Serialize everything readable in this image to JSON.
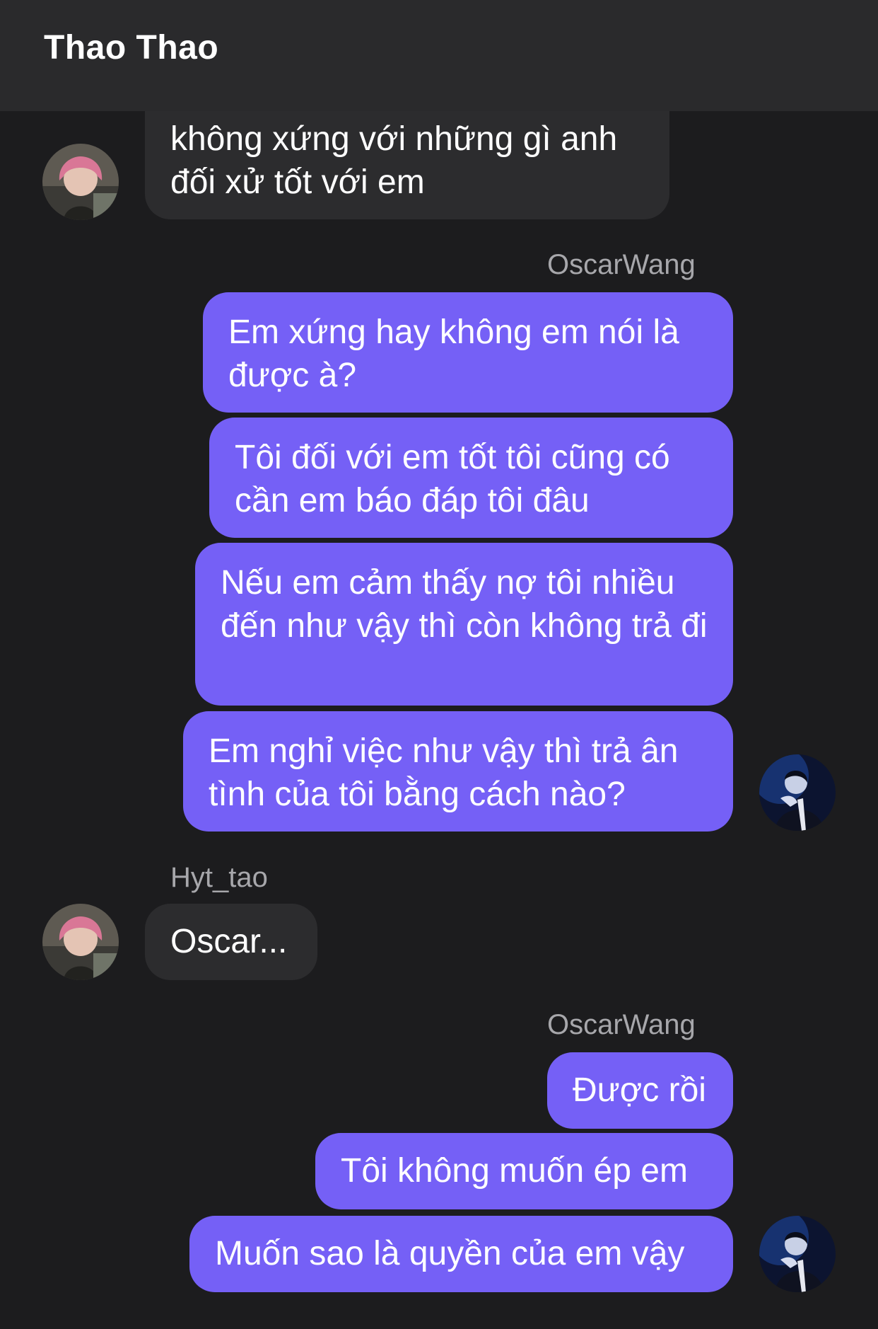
{
  "header": {
    "title": "Thao Thao"
  },
  "participants": {
    "me": "OscarWang",
    "other": "Hyt_tao"
  },
  "messages": {
    "m1": "không xứng với những gì anh đối xử tốt với em",
    "sender_block_1": "OscarWang",
    "m2": "Em xứng hay không em nói là được à?",
    "m3": "Tôi đối với em tốt tôi cũng có cần em báo đáp tôi đâu",
    "m4": "Nếu em cảm thấy nợ tôi nhiều đến như vậy thì còn không trả đi",
    "m5": "Em nghỉ việc như vậy thì trả ân tình của tôi bằng cách nào?",
    "sender_block_2": "Hyt_tao",
    "m6": "Oscar...",
    "sender_block_3": "OscarWang",
    "m7": "Được rồi",
    "m8": "Tôi không muốn ép em",
    "m9": "Muốn sao là quyền của em vậy"
  },
  "colors": {
    "background": "#1c1c1e",
    "header": "#2a2a2c",
    "incoming_bubble": "#2c2c2e",
    "outgoing_bubble": "#7560f6",
    "sender_label": "#a7a7ab"
  }
}
